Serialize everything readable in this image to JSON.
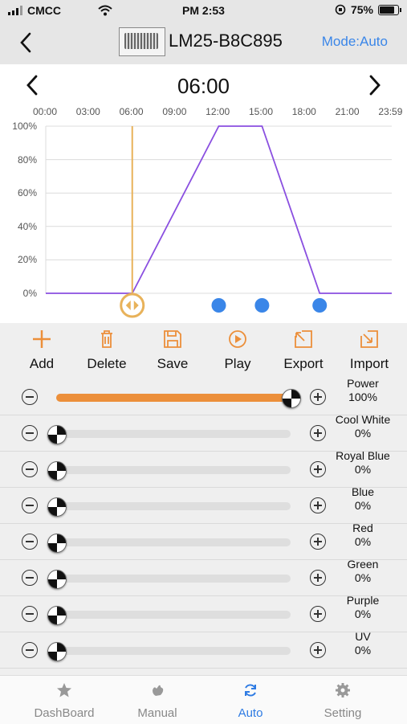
{
  "status": {
    "carrier": "CMCC",
    "time": "PM 2:53",
    "battery": "75%"
  },
  "nav": {
    "title": "LM25-B8C895",
    "mode": "Mode:Auto"
  },
  "schedule": {
    "current_time": "06:00",
    "time_ticks": [
      "00:00",
      "03:00",
      "06:00",
      "09:00",
      "12:00",
      "15:00",
      "18:00",
      "21:00",
      "23:59"
    ],
    "y_ticks": [
      "100%",
      "80%",
      "60%",
      "40%",
      "20%",
      "0%"
    ]
  },
  "chart_data": {
    "type": "line",
    "x_unit": "hours",
    "x_range": [
      0,
      24
    ],
    "ylim": [
      0,
      100
    ],
    "series": [
      {
        "x": [
          0,
          6,
          12,
          15,
          19,
          24
        ],
        "y": [
          0,
          0,
          100,
          100,
          0,
          0
        ]
      }
    ],
    "cursor_time": 6,
    "points": [
      6,
      12,
      15,
      19
    ]
  },
  "toolbar": {
    "add": "Add",
    "delete": "Delete",
    "save": "Save",
    "play": "Play",
    "export": "Export",
    "import": "Import"
  },
  "channels": [
    {
      "name": "Power",
      "value": "100%",
      "level": 1.0
    },
    {
      "name": "Cool White",
      "value": "0%",
      "level": 0
    },
    {
      "name": "Royal Blue",
      "value": "0%",
      "level": 0
    },
    {
      "name": "Blue",
      "value": "0%",
      "level": 0
    },
    {
      "name": "Red",
      "value": "0%",
      "level": 0
    },
    {
      "name": "Green",
      "value": "0%",
      "level": 0
    },
    {
      "name": "Purple",
      "value": "0%",
      "level": 0
    },
    {
      "name": "UV",
      "value": "0%",
      "level": 0
    }
  ],
  "tabs": [
    {
      "label": "DashBoard",
      "icon": "star-icon"
    },
    {
      "label": "Manual",
      "icon": "hand-icon"
    },
    {
      "label": "Auto",
      "icon": "refresh-icon",
      "active": true
    },
    {
      "label": "Setting",
      "icon": "gear-icon"
    }
  ],
  "colors": {
    "accent": "#2e7be3",
    "slider_fill": "#ec8f3a",
    "curve": "#8a4fe0",
    "cursor": "#e8b25a",
    "point": "#3a86e8"
  }
}
